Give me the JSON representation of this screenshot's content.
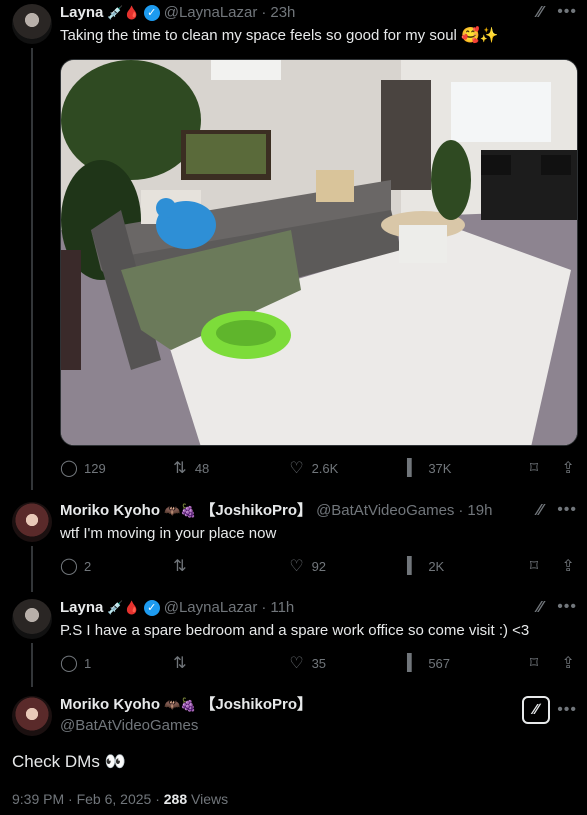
{
  "tweets": [
    {
      "name": "Layna",
      "name_emoji": "💉🩸",
      "handle": "@LaynaLazar",
      "time": "23h",
      "text": "Taking the time to clean my space feels so good for my soul 🥰✨",
      "replies": "129",
      "reposts": "48",
      "likes": "2.6K",
      "views": "37K"
    },
    {
      "name": "Moriko Kyoho",
      "name_emoji": "🦇🍇",
      "name_suffix": "【JoshikoPro】",
      "handle": "@BatAtVideoGames",
      "time": "19h",
      "text": "wtf I'm moving in your place now",
      "replies": "2",
      "reposts": "",
      "likes": "92",
      "views": "2K"
    },
    {
      "name": "Layna",
      "name_emoji": "💉🩸",
      "handle": "@LaynaLazar",
      "time": "11h",
      "text": "P.S I have a spare bedroom and a spare work office so come visit :) <3",
      "replies": "1",
      "reposts": "",
      "likes": "35",
      "views": "567"
    }
  ],
  "main": {
    "name": "Moriko Kyoho",
    "name_emoji": "🦇🍇",
    "name_suffix": "【JoshikoPro】",
    "handle": "@BatAtVideoGames",
    "text": "Check DMs 👀",
    "timestamp": "9:39 PM · Feb 6, 2025 · ",
    "views_count": "288",
    "views_label": " Views"
  },
  "icons": {
    "reply": "reply-icon",
    "repost": "repost-icon",
    "like": "heart-icon",
    "views": "views-icon",
    "bookmark": "bookmark-icon",
    "share": "share-icon",
    "grok": "grok-icon",
    "more": "more-icon",
    "verified": "verified-badge-icon"
  },
  "colors": {
    "background": "#000000",
    "text": "#e7e9ea",
    "muted": "#71767b",
    "verified": "#1d9bf0"
  }
}
